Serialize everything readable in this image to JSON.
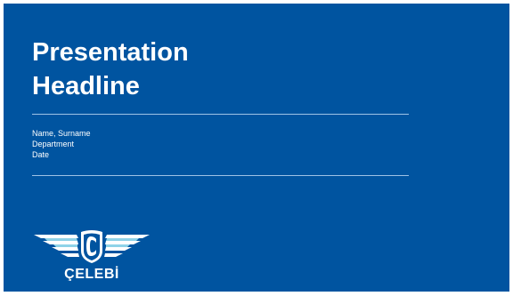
{
  "slide": {
    "background": "#0054a0",
    "title_line1": "Presentation",
    "title_line2": "Headline",
    "name": "Name, Surname",
    "department": "Department",
    "date": "Date",
    "divider_color": "#9ec3e6"
  },
  "logo": {
    "text": "ÇELEBİ",
    "icon": "celebi-winged-logo-icon"
  }
}
